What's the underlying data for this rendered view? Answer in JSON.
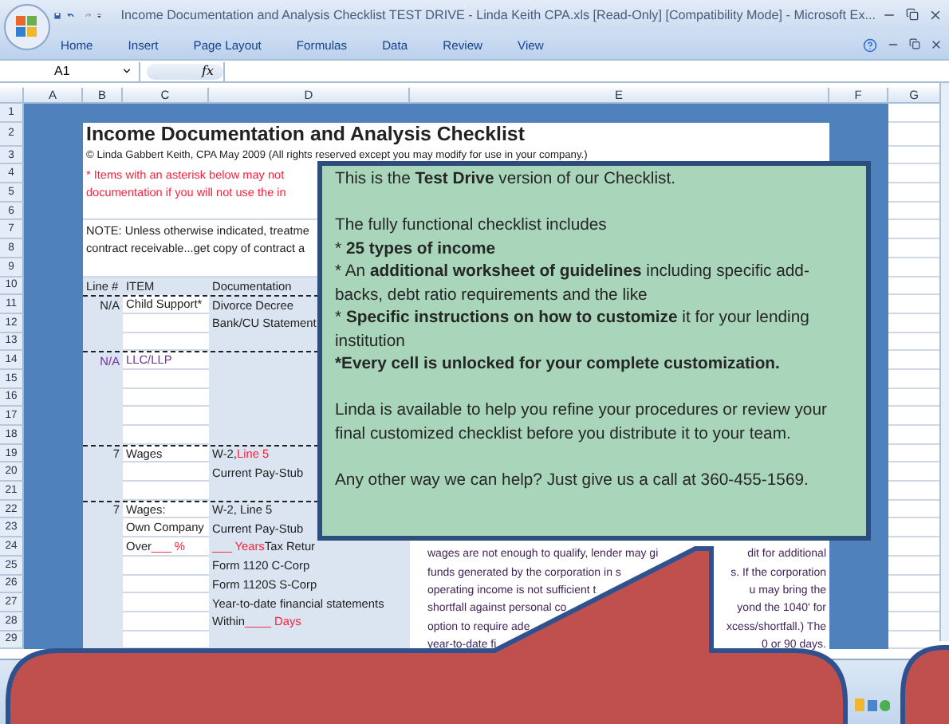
{
  "window": {
    "title": "Income Documentation and Analysis Checklist TEST DRIVE - Linda Keith CPA.xls  [Read-Only]  [Compatibility Mode] - Microsoft Ex..."
  },
  "ribbon_tabs": [
    {
      "label": "Home",
      "selected": false
    },
    {
      "label": "Insert",
      "selected": false
    },
    {
      "label": "Page Layout",
      "selected": false
    },
    {
      "label": "Formulas",
      "selected": false
    },
    {
      "label": "Data",
      "selected": false
    },
    {
      "label": "Review",
      "selected": false
    },
    {
      "label": "View",
      "selected": false
    }
  ],
  "formula_bar": {
    "name_box": "A1",
    "fx": "fx"
  },
  "sheet": {
    "columns": [
      "A",
      "B",
      "C",
      "D",
      "E",
      "F",
      "G"
    ],
    "rows": [
      {
        "number": "1",
        "kind": "blank",
        "divider_above": false
      },
      {
        "number": "2",
        "kind": "title",
        "divider_above": false,
        "text": [
          {
            "text": "Income Documentation and Analysis Checklist"
          }
        ]
      },
      {
        "number": "3",
        "kind": "copyright",
        "divider_above": false,
        "text": [
          {
            "text": "© Linda Gabbert Keith, CPA May 2009 (All rights reserved except you may modify for use in your company.)"
          }
        ]
      },
      {
        "number": "4",
        "kind": "banner",
        "divider_above": false,
        "text": [
          {
            "text": "* Items with an asterisk below may not",
            "color": "#ff1f3a"
          }
        ]
      },
      {
        "number": "5",
        "kind": "banner",
        "divider_above": false,
        "text": [
          {
            "text": "documentation if you will not use the in",
            "color": "#ff1f3a"
          }
        ]
      },
      {
        "number": "6",
        "kind": "blank",
        "divider_above": false
      },
      {
        "number": "7",
        "kind": "banner",
        "divider_above": false,
        "text": [
          {
            "text": "NOTE: Unless otherwise indicated, treatme"
          }
        ]
      },
      {
        "number": "8",
        "kind": "banner",
        "divider_above": false,
        "text": [
          {
            "text": "contract receivable...get copy of contract a"
          }
        ]
      },
      {
        "number": "9",
        "kind": "blank",
        "divider_above": false
      },
      {
        "number": "10",
        "kind": "header",
        "divider_above": false,
        "line_no": [
          {
            "text": "Line #"
          }
        ],
        "item": [
          {
            "text": "ITEM"
          }
        ],
        "documentation": [
          {
            "text": "Documentation"
          }
        ]
      },
      {
        "number": "11",
        "kind": "entry",
        "divider_above": true,
        "line_no": [
          {
            "text": "N/A"
          }
        ],
        "item": [
          {
            "text": "Child Support*"
          }
        ],
        "documentation": [
          {
            "text": "Divorce Decree"
          }
        ]
      },
      {
        "number": "12",
        "kind": "entry",
        "divider_above": false,
        "documentation": [
          {
            "text": "Bank/CU Statement"
          }
        ]
      },
      {
        "number": "13",
        "kind": "entry",
        "divider_above": false
      },
      {
        "number": "14",
        "kind": "entry",
        "divider_above": true,
        "line_no": [
          {
            "text": "N/A",
            "color": "#7030a0"
          }
        ],
        "item": [
          {
            "text": "LLC/LLP",
            "color": "#7030a0"
          }
        ]
      },
      {
        "number": "15",
        "kind": "entry",
        "divider_above": false
      },
      {
        "number": "16",
        "kind": "entry",
        "divider_above": false
      },
      {
        "number": "17",
        "kind": "entry",
        "divider_above": false
      },
      {
        "number": "18",
        "kind": "entry",
        "divider_above": false
      },
      {
        "number": "19",
        "kind": "entry",
        "divider_above": true,
        "line_no": [
          {
            "text": "7"
          }
        ],
        "item": [
          {
            "text": "Wages"
          }
        ],
        "documentation": [
          {
            "text": "W-2, "
          },
          {
            "text": "Line 5",
            "color": "#ff1f3a"
          }
        ]
      },
      {
        "number": "20",
        "kind": "entry",
        "divider_above": false,
        "documentation": [
          {
            "text": "Current Pay-Stub"
          }
        ]
      },
      {
        "number": "21",
        "kind": "entry",
        "divider_above": false
      },
      {
        "number": "22",
        "kind": "entry",
        "divider_above": true,
        "line_no": [
          {
            "text": "7"
          }
        ],
        "item": [
          {
            "text": "Wages:"
          }
        ],
        "documentation": [
          {
            "text": "W-2, Line 5"
          }
        ]
      },
      {
        "number": "23",
        "kind": "entry",
        "divider_above": false,
        "item": [
          {
            "text": "Own Company"
          }
        ],
        "documentation": [
          {
            "text": "Current Pay-Stub"
          }
        ]
      },
      {
        "number": "24",
        "kind": "entry",
        "divider_above": false,
        "item": [
          {
            "text": "Over "
          },
          {
            "text": "___ %",
            "color": "#ff1f3a"
          }
        ],
        "documentation": [
          {
            "text": "___ Years",
            "color": "#ff1f3a"
          },
          {
            "text": " Tax Retur"
          }
        ],
        "guidance": [
          {
            "left": "wages are not enough to qualify, lender may gi",
            "right": "dit for additional"
          },
          {
            "left": "funds generated by the corporation in s",
            "right": "s. If the corporation"
          },
          {
            "left": "operating income is not sufficient t",
            "right": "u may bring the"
          },
          {
            "left": "shortfall against personal co",
            "right": "yond the 1040' for"
          },
          {
            "left": "option to require ade",
            "right": "xcess/shortfall.) The"
          },
          {
            "left": "year-to-date fi",
            "right": "0 or 90 days."
          }
        ]
      },
      {
        "number": "25",
        "kind": "entry",
        "divider_above": false,
        "documentation": [
          {
            "text": "Form 1120 C-Corp"
          }
        ]
      },
      {
        "number": "26",
        "kind": "entry",
        "divider_above": false,
        "documentation": [
          {
            "text": "Form 1120S S-Corp"
          }
        ]
      },
      {
        "number": "27",
        "kind": "entry",
        "divider_above": false,
        "documentation": [
          {
            "text": "Year-to-date financial statements"
          }
        ]
      },
      {
        "number": "28",
        "kind": "entry",
        "divider_above": false,
        "documentation": [
          {
            "text": "Within "
          },
          {
            "text": "____ Days",
            "color": "#ff1f3a"
          }
        ]
      },
      {
        "number": "29",
        "kind": "entry",
        "divider_above": false
      }
    ]
  },
  "callout": {
    "paragraphs": [
      {
        "lines": [
          {
            "text": "This is the **Test Drive** version of our Checklist.",
            "strong": false
          }
        ]
      },
      {
        "lines": [
          {
            "text": "The fully functional checklist includes",
            "strong": false
          },
          {
            "bullet": "* ",
            "text": "**25 types of income**",
            "strong": false
          },
          {
            "bullet": "* ",
            "text": "An **additional worksheet of guidelines** including specific add-backs, debt ratio requirements and the like",
            "strong": false
          },
          {
            "bullet": "* ",
            "text": "**Specific instructions on how to customize** it for your lending institution",
            "strong": false
          },
          {
            "bullet": "*",
            "text": "Every cell is unlocked for your complete customization.",
            "strong": true
          }
        ]
      },
      {
        "lines": [
          {
            "text": "Linda is available to help you refine your procedures or review your final customized checklist before you distribute it to your team.",
            "strong": false
          }
        ]
      },
      {
        "lines": [
          {
            "text": "Any other way we can help? Just give us a call at 360-455-1569.",
            "strong": false
          }
        ]
      }
    ]
  }
}
